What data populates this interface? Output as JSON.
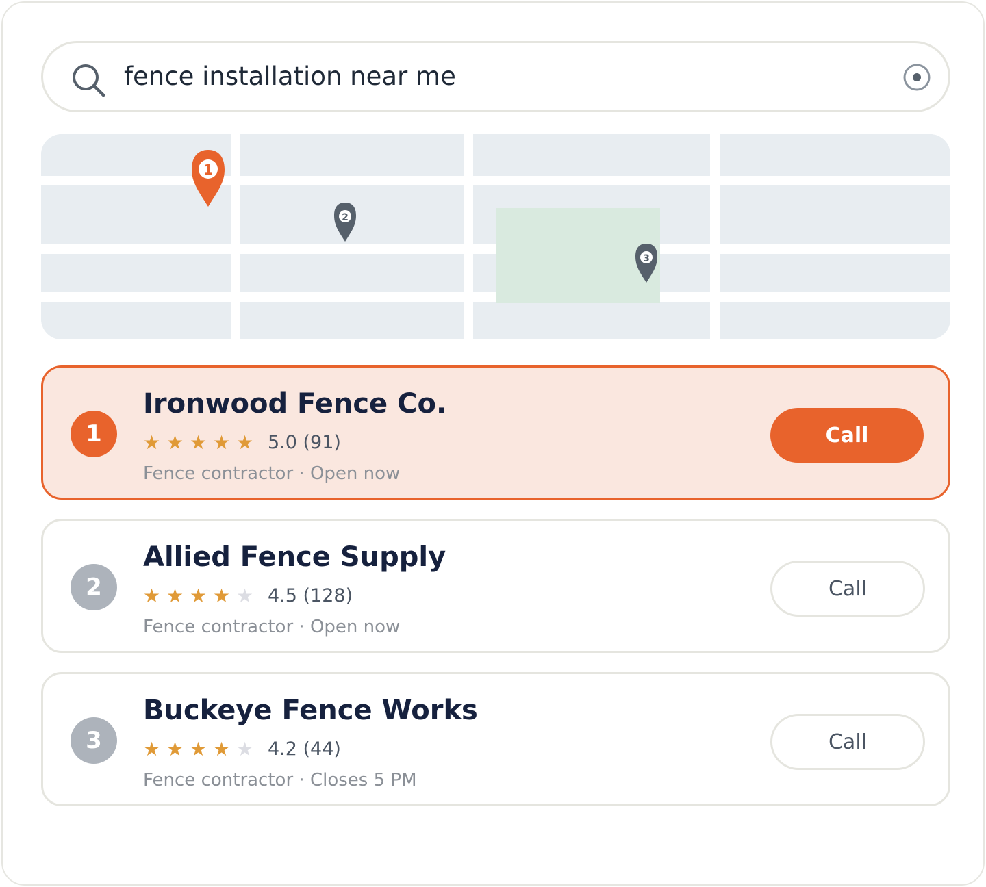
{
  "search": {
    "query": "fence installation near me",
    "icons": {
      "search": "search-icon",
      "locate": "locate-icon"
    }
  },
  "map": {
    "pins": [
      {
        "number": "1",
        "color": "#e8632c",
        "selected": true
      },
      {
        "number": "2",
        "color": "#56606b",
        "selected": false
      },
      {
        "number": "3",
        "color": "#56606b",
        "selected": false
      }
    ],
    "colors": {
      "block": "#e8edf1",
      "road": "#ffffff",
      "park": "#d9eadf"
    }
  },
  "results": [
    {
      "rank": "1",
      "name": "Ironwood Fence Co.",
      "stars": 5,
      "rating": "5.0 (91)",
      "meta": "Fence contractor · Open now",
      "call_label": "Call",
      "active": true
    },
    {
      "rank": "2",
      "name": "Allied Fence Supply",
      "stars": 4,
      "rating": "4.5 (128)",
      "meta": "Fence contractor · Open now",
      "call_label": "Call",
      "active": false
    },
    {
      "rank": "3",
      "name": "Buckeye Fence Works",
      "stars": 4,
      "rating": "4.2 (44)",
      "meta": "Fence contractor · Closes 5 PM",
      "call_label": "Call",
      "active": false
    }
  ],
  "colors": {
    "accent": "#e8632c",
    "accent_bg": "#fae7df",
    "star": "#e09a37",
    "star_off": "#dcdde3"
  }
}
